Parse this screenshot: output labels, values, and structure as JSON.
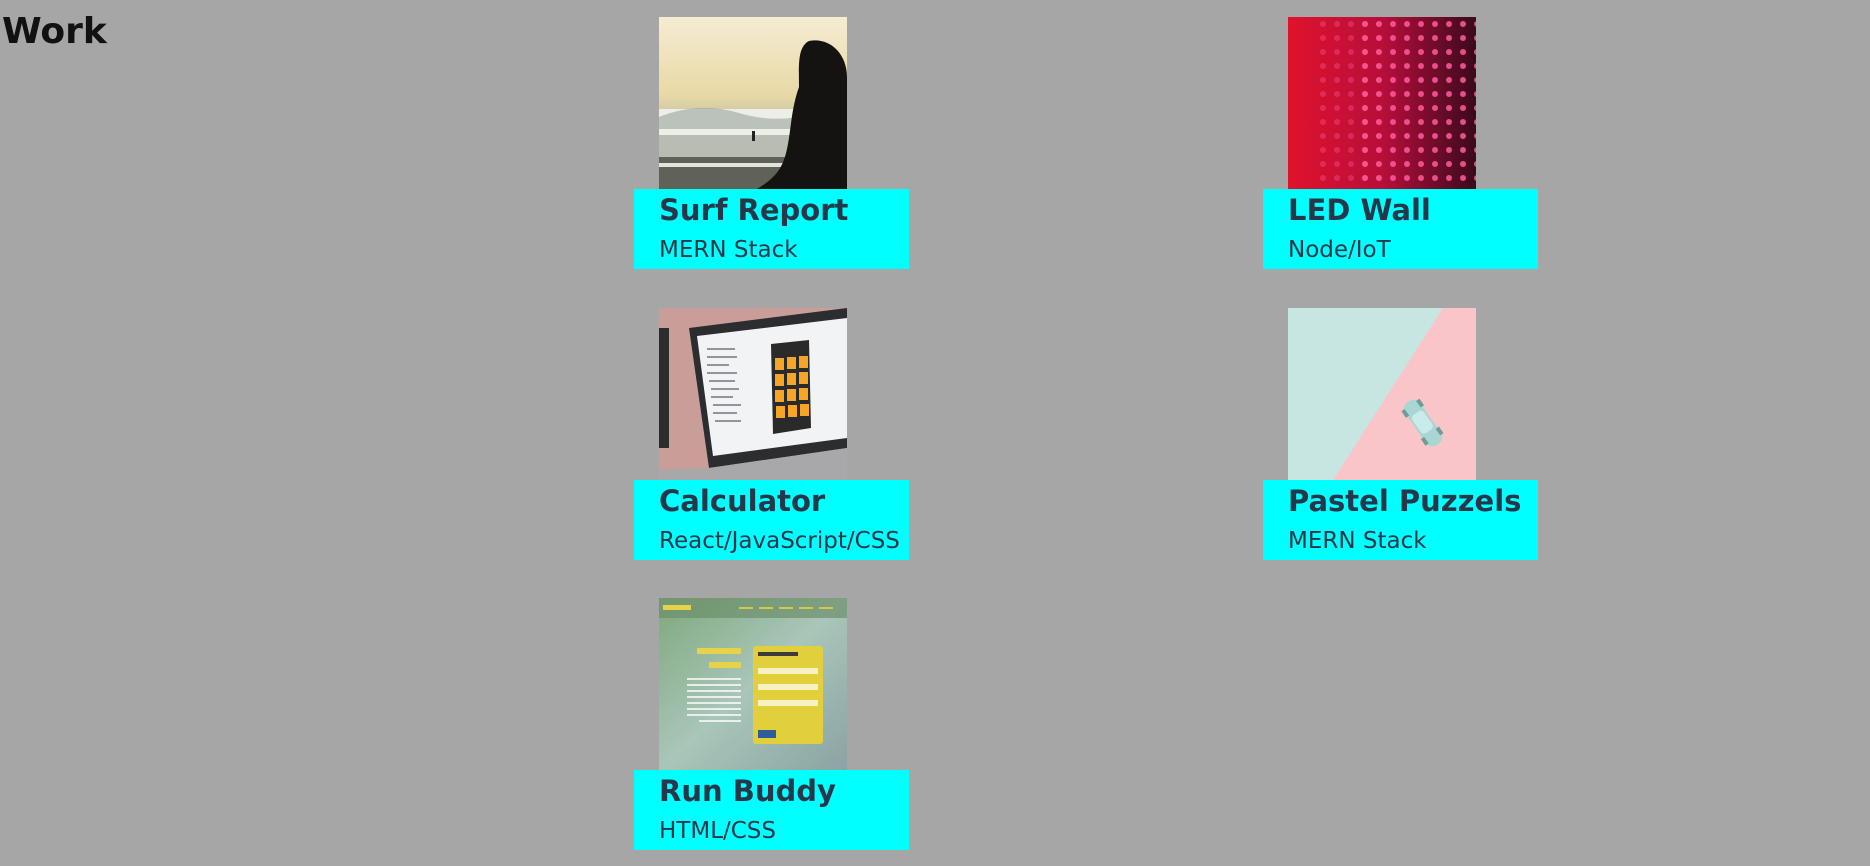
{
  "section": {
    "title": "Work"
  },
  "projects": [
    {
      "title": "Surf Report",
      "tech": "MERN Stack",
      "image_icon": "surf-photo"
    },
    {
      "title": "LED Wall",
      "tech": "Node/IoT",
      "image_icon": "led-wall-photo"
    },
    {
      "title": "Calculator",
      "tech": "React/JavaScript/CSS",
      "image_icon": "calculator-photo"
    },
    {
      "title": "Pastel Puzzels",
      "tech": "MERN Stack",
      "image_icon": "toy-car-photo"
    },
    {
      "title": "Run Buddy",
      "tech": "HTML/CSS",
      "image_icon": "run-buddy-screenshot"
    }
  ],
  "colors": {
    "background": "#a6a6a6",
    "caption_background": "#00ffff",
    "caption_text": "#26374a"
  }
}
